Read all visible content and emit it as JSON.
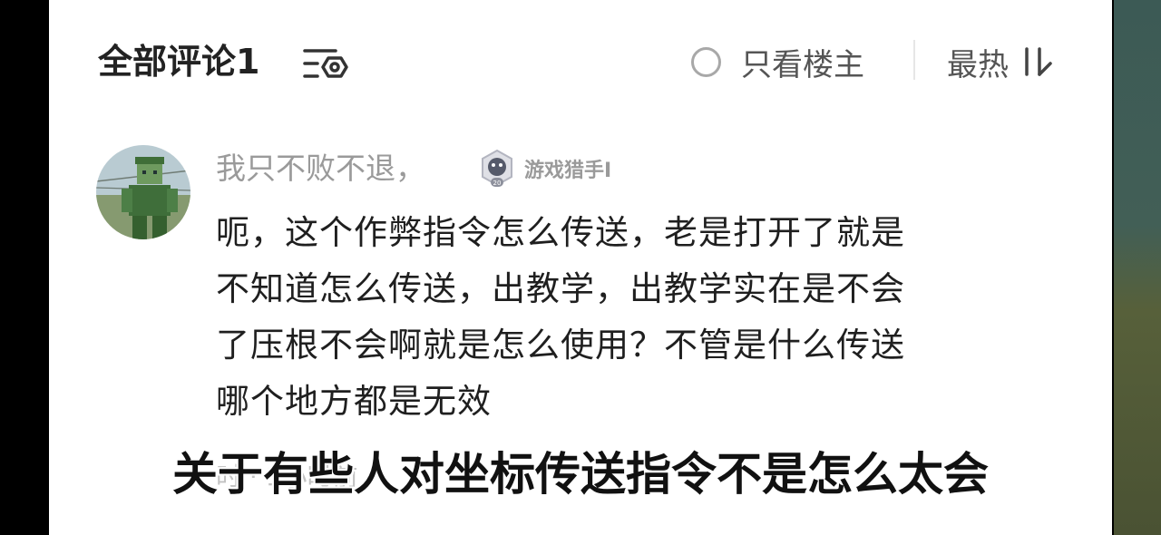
{
  "header": {
    "title": "全部评论1",
    "filter_icon": "filter-icon",
    "only_op_label": "只看楼主",
    "sort_label": "最热",
    "sort_icon": "sort-icon"
  },
  "comment": {
    "username": "我只不败不退，",
    "badge_label": "游戏猎手I",
    "badge_level": "20",
    "text_lines": [
      "呃，这个作弊指令怎么传送，老是打开了就是",
      "不知道怎么传送，出教学，出教学实在是不会",
      "了压根不会啊就是怎么使用？不管是什么传送",
      "哪个地方都是无效"
    ],
    "meta_partial": "时 · 1小时前"
  },
  "subtitle": "关于有些人对坐标传送指令不是怎么太会",
  "colors": {
    "card_bg": "#ffffff",
    "title": "#222222",
    "secondary_text": "#9a9a9a",
    "body_text": "#1f1f1f"
  }
}
